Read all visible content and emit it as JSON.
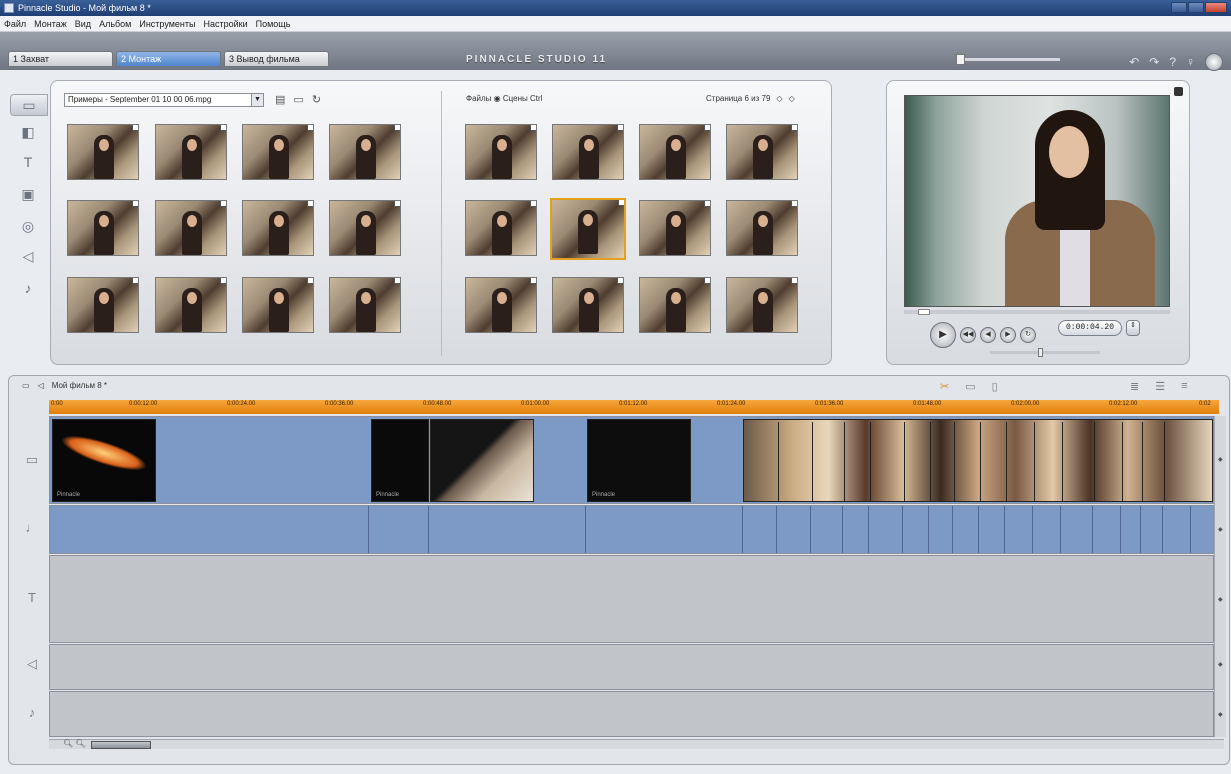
{
  "window": {
    "title": "Pinnacle Studio - Мой фильм 8 *"
  },
  "menu": [
    "Файл",
    "Монтаж",
    "Вид",
    "Альбом",
    "Инструменты",
    "Настройки",
    "Помощь"
  ],
  "mode_tabs": [
    {
      "label": "1 Захват",
      "active": false
    },
    {
      "label": "2 Монтаж",
      "active": true
    },
    {
      "label": "3 Вывод фильма",
      "active": false
    }
  ],
  "brand": "PINNACLE STUDIO 11",
  "album": {
    "source_select": "Примеры - September 01 10 00 06.mpg",
    "view_options": "Файлы ◉ Сцены Ctrl",
    "page_info": "Страница 6 из 79"
  },
  "player": {
    "timecode": "0:00:04.20"
  },
  "timeline": {
    "project_title": "Мой фильм 8 *",
    "ruler_ticks": [
      "0:00",
      "0:00:12.00",
      "0:00:24.00",
      "0:00:36.00",
      "0:00:48.00",
      "0:01:00.00",
      "0:01:12.00",
      "0:01:24.00",
      "0:01:36.00",
      "0:01:48.00",
      "0:02:00.00",
      "0:02:12.00",
      "0:02"
    ]
  },
  "colors": {
    "accent": "#4f86cf",
    "ruler": "#f0961f",
    "track": "#7d9ac6",
    "selection": "#e3a01a"
  },
  "icons": [
    "album-scenes-icon",
    "transitions-icon",
    "titles-icon",
    "photos-icon",
    "menus-icon",
    "sound-effects-icon",
    "music-icon"
  ]
}
